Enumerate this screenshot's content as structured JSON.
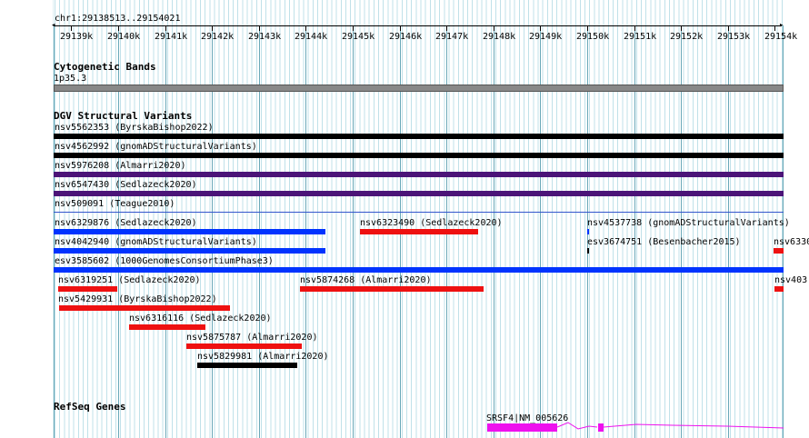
{
  "ruler": {
    "location": "chr1:29138513..29154021",
    "ticks": [
      "29139k",
      "29140k",
      "29141k",
      "29142k",
      "29143k",
      "29144k",
      "29145k",
      "29146k",
      "29147k",
      "29148k",
      "29149k",
      "29150k",
      "29151k",
      "29152k",
      "29153k",
      "29154k"
    ]
  },
  "tracks": {
    "cytoband": {
      "title": "Cytogenetic Bands",
      "band_label": "1p35.3",
      "band_color": "#888888"
    },
    "dgv": {
      "title": "DGV Structural Variants",
      "colors": {
        "black": "#000000",
        "purple": "#4b1478",
        "blue": "#0033ff",
        "red": "#ee1111"
      },
      "features": [
        {
          "label": "nsv5562353 (ByrskaBishop2022)"
        },
        {
          "label": "nsv4562992 (gnomADStructuralVariants)"
        },
        {
          "label": "nsv5976208 (Almarri2020)"
        },
        {
          "label": "nsv6547430 (Sedlazeck2020)"
        },
        {
          "label": "nsv509091 (Teague2010)"
        },
        {
          "label": "nsv6329876 (Sedlazeck2020)"
        },
        {
          "label": "nsv6323490 (Sedlazeck2020)"
        },
        {
          "label": "nsv4537738 (gnomADStructuralVariants)"
        },
        {
          "label": "nsv4042940 (gnomADStructuralVariants)"
        },
        {
          "label": "esv3674751 (Besenbacher2015)"
        },
        {
          "label": "nsv6330"
        },
        {
          "label": "esv3585602 (1000GenomesConsortiumPhase3)"
        },
        {
          "label": "nsv6319251 (Sedlazeck2020)"
        },
        {
          "label": "nsv5874268 (Almarri2020)"
        },
        {
          "label": "nsv403"
        },
        {
          "label": "nsv5429931 (ByrskaBishop2022)"
        },
        {
          "label": "nsv6316116 (Sedlazeck2020)"
        },
        {
          "label": "nsv5875787 (Almarri2020)"
        },
        {
          "label": "nsv5829981 (Almarri2020)"
        }
      ]
    },
    "refseq": {
      "title": "RefSeq Genes",
      "gene_label": "SRSF4|NM_005626",
      "exon_color": "#ee11ee"
    }
  }
}
